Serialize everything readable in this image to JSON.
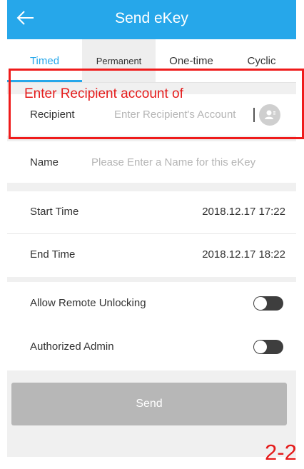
{
  "header": {
    "title": "Send eKey",
    "back_icon": "back-arrow-icon"
  },
  "tabs": [
    {
      "label": "Timed",
      "active": true
    },
    {
      "label": "Permanent",
      "active": false
    },
    {
      "label": "One-time",
      "active": false
    },
    {
      "label": "Cyclic",
      "active": false
    }
  ],
  "form": {
    "recipient": {
      "label": "Recipient",
      "placeholder": "Enter Recipient's Account",
      "contact_icon": "contact-book-icon"
    },
    "name": {
      "label": "Name",
      "placeholder": "Please Enter a Name for this eKey"
    },
    "start_time": {
      "label": "Start Time",
      "value": "2018.12.17 17:22"
    },
    "end_time": {
      "label": "End Time",
      "value": "2018.12.17 18:22"
    },
    "allow_remote_unlocking": {
      "label": "Allow Remote Unlocking",
      "enabled": false
    },
    "authorized_admin": {
      "label": "Authorized Admin",
      "enabled": false
    }
  },
  "send_label": "Send",
  "annotation": {
    "text": "Enter Recipient account of",
    "page_number": "2-2",
    "color": "#e51b1b"
  },
  "colors": {
    "accent": "#26a7ea",
    "toggle_off": "#3e3e3e",
    "send_disabled": "#b7b7b7"
  }
}
